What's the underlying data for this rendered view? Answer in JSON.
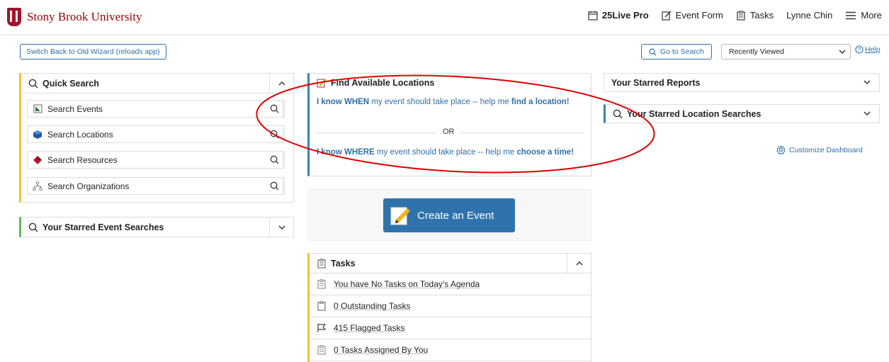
{
  "header": {
    "logo_text": "Stony Brook University",
    "nav": [
      {
        "label": "25Live Pro",
        "icon": "calendar-icon"
      },
      {
        "label": "Event Form",
        "icon": "edit-icon"
      },
      {
        "label": "Tasks",
        "icon": "clipboard-icon"
      },
      {
        "label": "Lynne Chin"
      },
      {
        "label": "More",
        "icon": "menu-icon"
      }
    ]
  },
  "toolbar": {
    "switch_label": "Switch Back to Old Wizard (reloads app)",
    "go_to_search": "Go to Search",
    "recently_viewed": "Recently Viewed",
    "help": "Help"
  },
  "quick_search": {
    "title": "Quick Search",
    "items": [
      {
        "label": "Search Events",
        "icon": "event-icon"
      },
      {
        "label": "Search Locations",
        "icon": "location-cube-icon"
      },
      {
        "label": "Search Resources",
        "icon": "resource-icon"
      },
      {
        "label": "Search Organizations",
        "icon": "organization-icon"
      }
    ]
  },
  "starred_event_searches": {
    "title": "Your Starred Event Searches"
  },
  "find_locations": {
    "title": "Find Available Locations",
    "option1_strong": "I know WHEN",
    "option1_mid": " my event should take place -- help me ",
    "option1_link": "find a location!",
    "or": "OR",
    "option2_strong": "I know WHERE",
    "option2_mid": " my event should take place -- help me ",
    "option2_link": "choose a time!"
  },
  "create_event": {
    "label": "Create an Event"
  },
  "tasks": {
    "title": "Tasks",
    "items": [
      {
        "label": "You have No Tasks on Today's Agenda",
        "icon": "clipboard-icon"
      },
      {
        "label": "0 Outstanding Tasks",
        "icon": "clipboard-blank-icon"
      },
      {
        "label": "415 Flagged Tasks",
        "icon": "flag-icon"
      },
      {
        "label": "0 Tasks Assigned By You",
        "icon": "clipboard-icon"
      }
    ]
  },
  "starred_reports": {
    "title": "Your Starred Reports"
  },
  "starred_location_searches": {
    "title": "Your Starred Location Searches"
  },
  "customize": {
    "label": "Customize Dashboard"
  },
  "colors": {
    "accent": "#2f6fa7",
    "brand": "#990000",
    "annotation": "#e00000"
  }
}
